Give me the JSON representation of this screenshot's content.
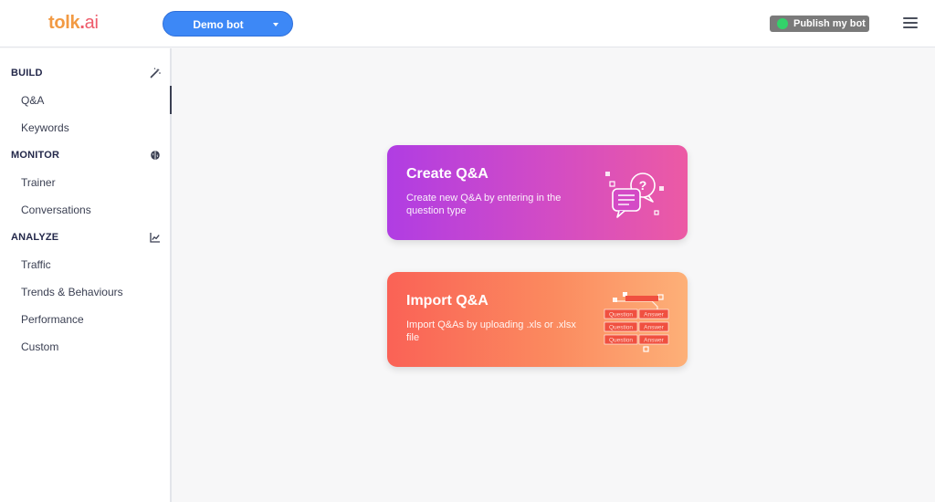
{
  "header": {
    "logo": {
      "part1": "tolk",
      "part2": ".",
      "part3": "ai"
    },
    "bot_selector": {
      "label": "Demo bot",
      "icon": "caret-down-icon"
    },
    "publish_button": {
      "label": "Publish my bot",
      "status_color": "#33d26a"
    },
    "menu_icon": "hamburger-menu-icon"
  },
  "sidebar": {
    "sections": [
      {
        "title": "BUILD",
        "icon": "magic-wand-icon",
        "items": [
          "Q&A",
          "Keywords"
        ]
      },
      {
        "title": "MONITOR",
        "icon": "brain-icon",
        "items": [
          "Trainer",
          "Conversations"
        ]
      },
      {
        "title": "ANALYZE",
        "icon": "chart-line-icon",
        "items": [
          "Traffic",
          "Trends & Behaviours",
          "Performance",
          "Custom"
        ]
      }
    ],
    "active_item": "Q&A"
  },
  "cards": {
    "create": {
      "title": "Create Q&A",
      "description": "Create new Q&A by entering in the question type",
      "icon": "chat-question-icon"
    },
    "import": {
      "title": "Import Q&A",
      "description": "Import Q&As by uploading .xls or .xlsx file",
      "icon": "spreadsheet-icon",
      "table_labels": {
        "question": "Question",
        "answer": "Answer"
      }
    }
  },
  "colors": {
    "brand_orange": "#f29a43",
    "brand_red": "#ee5a6a",
    "primary_blue": "#3d88f6",
    "create_gradient": [
      "#b03de3",
      "#ec5aa4"
    ],
    "import_gradient": [
      "#fa6256",
      "#fdb078"
    ]
  }
}
